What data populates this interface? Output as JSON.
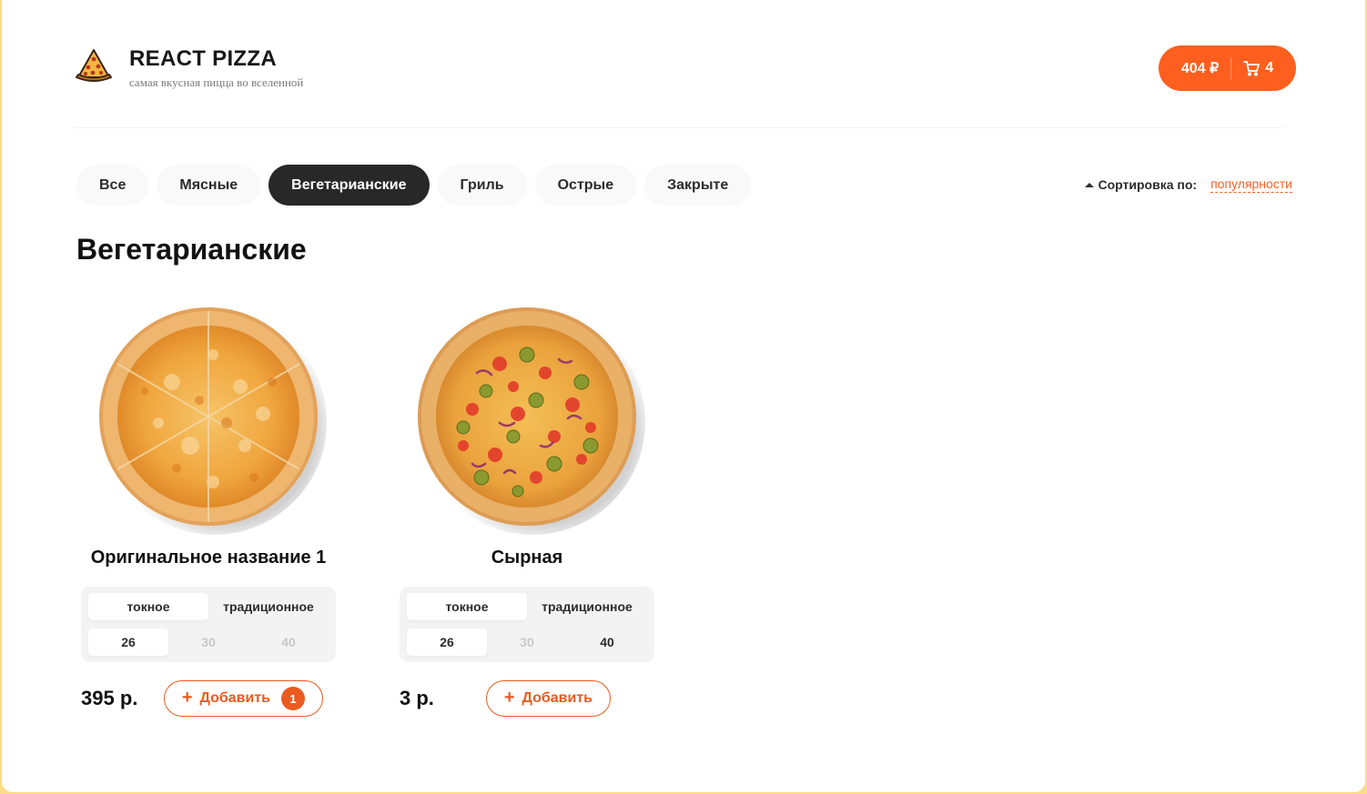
{
  "header": {
    "title": "REACT PIZZA",
    "subtitle": "самая вкусная пицца во вселенной",
    "cart_total": "404 ₽",
    "cart_count": "4"
  },
  "categories": [
    "Все",
    "Мясные",
    "Вегетарианские",
    "Гриль",
    "Острые",
    "Закрыте"
  ],
  "active_category": "Вегетарианские",
  "sort": {
    "label": "Сортировка по:",
    "value": "популярности"
  },
  "section_title": "Вегетарианские",
  "pizzas": [
    {
      "name": "Оригинальное название 1",
      "types": [
        "токное",
        "традиционное"
      ],
      "selected_type": "токное",
      "sizes": [
        "26",
        "30",
        "40"
      ],
      "available_sizes": [
        "26"
      ],
      "selected_size": "26",
      "price": "395 р.",
      "add_label": "Добавить",
      "count": "1"
    },
    {
      "name": "Сырная",
      "types": [
        "токное",
        "традиционное"
      ],
      "selected_type": "токное",
      "sizes": [
        "26",
        "30",
        "40"
      ],
      "available_sizes": [
        "26",
        "40"
      ],
      "selected_size": "26",
      "price": "3 р.",
      "add_label": "Добавить"
    }
  ],
  "colors": {
    "accent": "#fe5f1e",
    "active_tab": "#282828",
    "background": "#fcdc8a"
  }
}
